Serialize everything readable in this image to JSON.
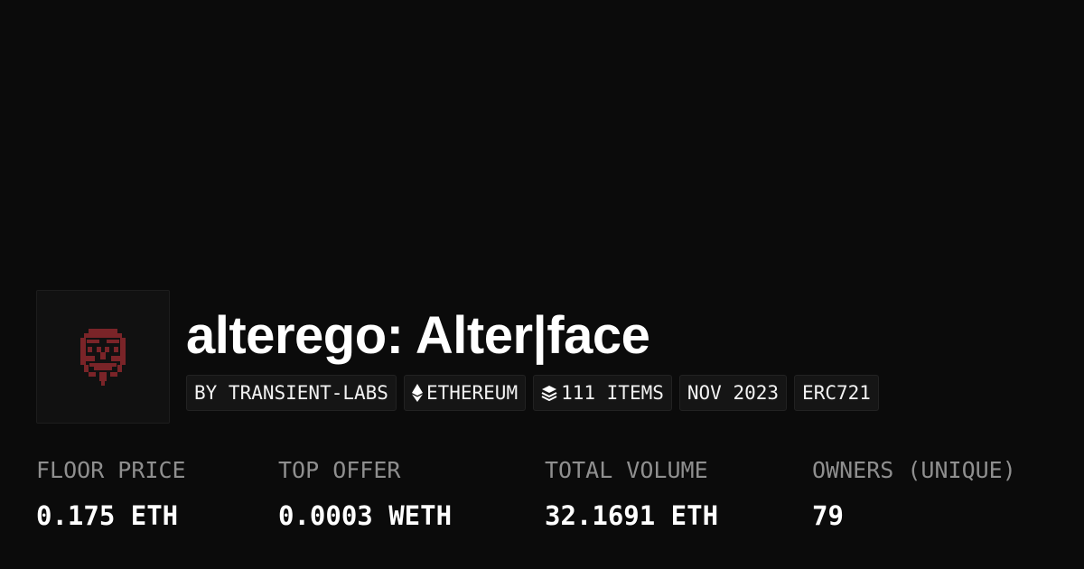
{
  "collection": {
    "title": "alterego: Alter|face",
    "avatar_icon": "red-mask-face-icon",
    "accent_color": "#7a2428",
    "tags": {
      "creator": "BY TRANSIENT-LABS",
      "chain": "ETHEREUM",
      "chain_icon": "ethereum-icon",
      "items": "111 ITEMS",
      "items_icon": "layers-icon",
      "date": "NOV 2023",
      "standard": "ERC721"
    }
  },
  "stats": {
    "floor_price": {
      "label": "FLOOR PRICE",
      "value": "0.175 ETH"
    },
    "top_offer": {
      "label": "TOP OFFER",
      "value": "0.0003 WETH"
    },
    "total_volume": {
      "label": "TOTAL VOLUME",
      "value": "32.1691 ETH"
    },
    "owners": {
      "label": "OWNERS (UNIQUE)",
      "value": "79"
    }
  }
}
